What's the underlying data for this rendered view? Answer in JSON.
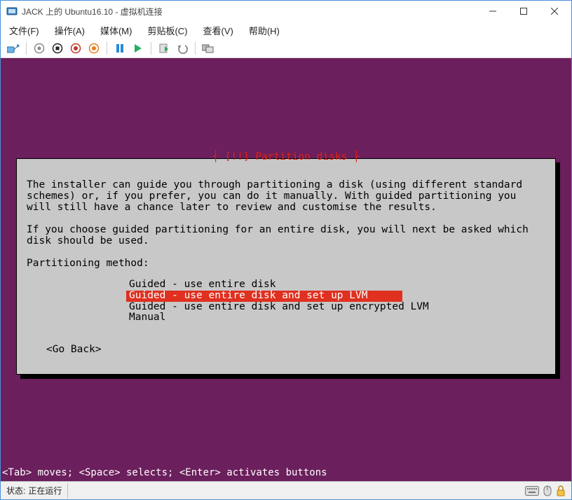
{
  "window": {
    "title": "JACK 上的 Ubuntu16.10 - 虚拟机连接"
  },
  "menu": {
    "file": "文件(F)",
    "action": "操作(A)",
    "media": "媒体(M)",
    "clipboard": "剪贴板(C)",
    "view": "查看(V)",
    "help": "帮助(H)"
  },
  "installer": {
    "title_plain": "[!!] Partition disks",
    "paragraph1": "The installer can guide you through partitioning a disk (using different standard schemes) or, if you prefer, you can do it manually. With guided partitioning you will still have a chance later to review and customise the results.",
    "paragraph2": "If you choose guided partitioning for an entire disk, you will next be asked which disk should be used.",
    "method_label": "Partitioning method:",
    "options": [
      "Guided - use entire disk",
      "Guided - use entire disk and set up LVM",
      "Guided - use entire disk and set up encrypted LVM",
      "Manual"
    ],
    "selected_index": 1,
    "go_back": "<Go Back>"
  },
  "hint": "<Tab> moves; <Space> selects; <Enter> activates buttons",
  "status": {
    "label": "状态:",
    "value": "正在运行"
  }
}
